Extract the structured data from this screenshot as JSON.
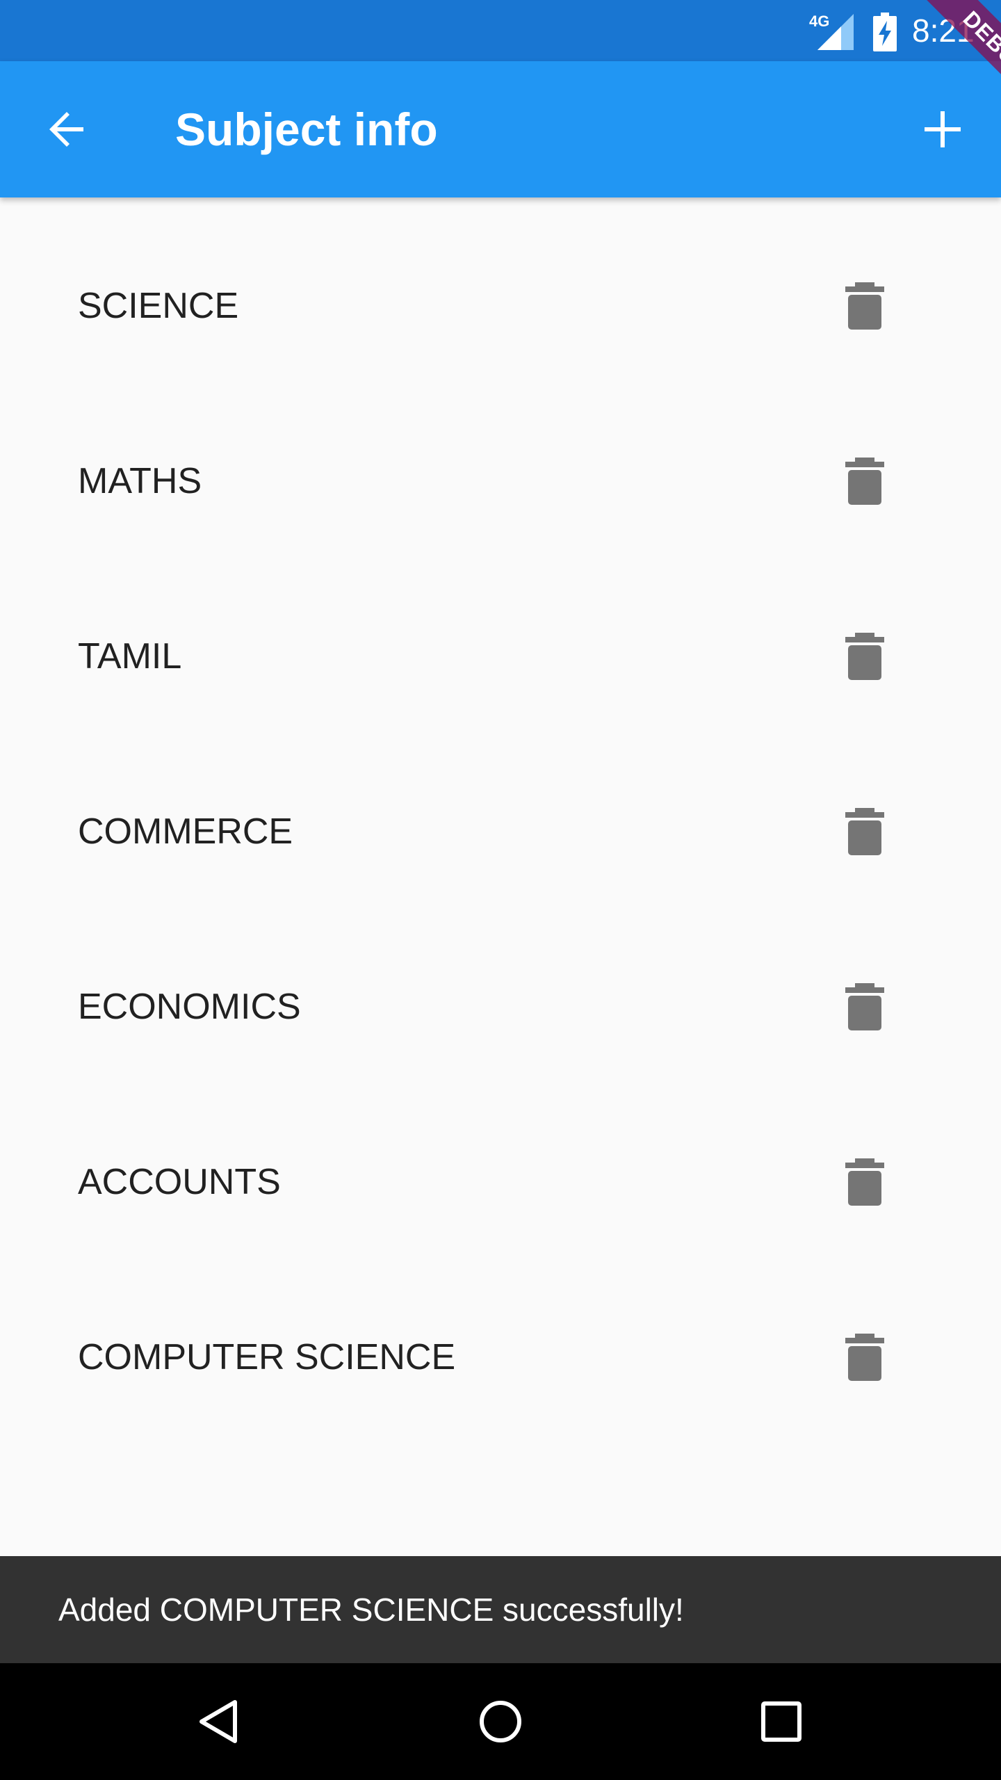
{
  "status_bar": {
    "network": "4G",
    "time": "8:21",
    "icons": [
      "signal-icon",
      "battery-charging-icon"
    ]
  },
  "app_bar": {
    "title": "Subject info",
    "back_icon": "arrow-back-icon",
    "add_icon": "add-icon"
  },
  "debug_banner": "DEBUG",
  "subjects": [
    {
      "label": "SCIENCE"
    },
    {
      "label": "MATHS"
    },
    {
      "label": "TAMIL"
    },
    {
      "label": "COMMERCE"
    },
    {
      "label": "ECONOMICS"
    },
    {
      "label": "ACCOUNTS"
    },
    {
      "label": "COMPUTER SCIENCE"
    }
  ],
  "snackbar": {
    "message": "Added COMPUTER SCIENCE successfully!"
  },
  "nav_bar": {
    "icons": [
      "back-triangle-icon",
      "home-circle-icon",
      "recents-square-icon"
    ]
  },
  "colors": {
    "status_bar": "#1976d2",
    "app_bar": "#2196f3",
    "background": "#fafafa",
    "icon_grey": "#757575",
    "snackbar": "#323232"
  }
}
